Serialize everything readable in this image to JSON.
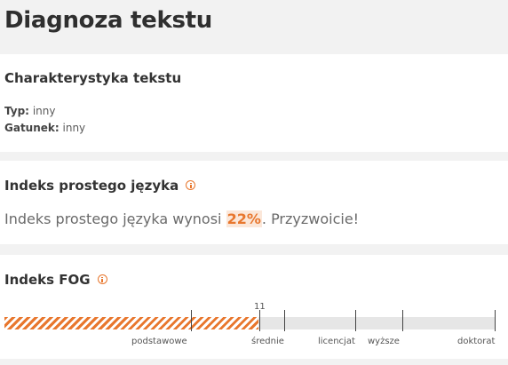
{
  "page": {
    "title": "Diagnoza tekstu"
  },
  "characteristics": {
    "title": "Charakterystyka tekstu",
    "type_key": "Typ:",
    "type_value": "inny",
    "genre_key": "Gatunek:",
    "genre_value": "inny"
  },
  "plain_language": {
    "title": "Indeks prostego języka",
    "sentence_prefix": "Indeks prostego języka wynosi ",
    "value": "22%",
    "sentence_suffix": ". Przyzwoicie!"
  },
  "fog": {
    "title": "Indeks FOG",
    "value": "11",
    "fill_fraction": 0.518,
    "accent_color": "#e8772e",
    "levels": [
      {
        "label": "podstawowe"
      },
      {
        "label": "średnie"
      },
      {
        "label": "licencjat"
      },
      {
        "label": "wyższe"
      },
      {
        "label": "doktorat"
      }
    ]
  },
  "icons": {
    "info": "info-icon"
  }
}
